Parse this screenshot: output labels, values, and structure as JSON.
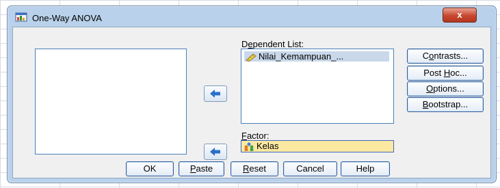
{
  "window": {
    "title": "One-Way ANOVA",
    "close_label": "x"
  },
  "dependent_list": {
    "label_pre": "D",
    "label_ul": "e",
    "label_post": "pendent List:",
    "items": [
      {
        "label": "Nilai_Kemampuan_...",
        "icon": "ruler-scale-icon"
      }
    ]
  },
  "factor": {
    "label_ul": "F",
    "label_post": "actor:",
    "value": "Kelas",
    "icon": "nominal-people-icon"
  },
  "side_buttons": [
    {
      "pre": "C",
      "ul": "o",
      "post": "ntrasts..."
    },
    {
      "pre": "Post ",
      "ul": "H",
      "post": "oc..."
    },
    {
      "pre": "",
      "ul": "O",
      "post": "ptions..."
    },
    {
      "pre": "",
      "ul": "B",
      "post": "ootstrap..."
    }
  ],
  "bottom_buttons": [
    {
      "pre": "OK",
      "ul": "",
      "post": ""
    },
    {
      "pre": "",
      "ul": "P",
      "post": "aste"
    },
    {
      "pre": "",
      "ul": "R",
      "post": "eset"
    },
    {
      "pre": "Cancel",
      "ul": "",
      "post": ""
    },
    {
      "pre": "Help",
      "ul": "",
      "post": ""
    }
  ],
  "colors": {
    "dialog_frame": "#b9d1ea",
    "factor_highlight": "#fbe9a2",
    "close_red": "#c7472f"
  }
}
